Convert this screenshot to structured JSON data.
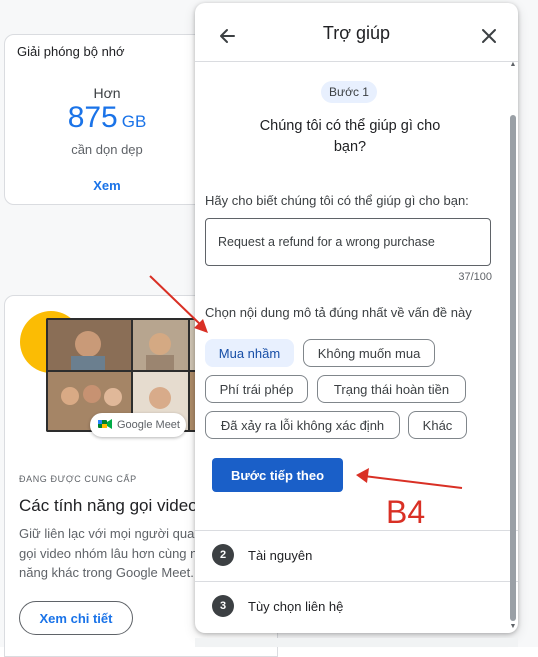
{
  "storage_card": {
    "title": "Giải phóng bộ nhớ",
    "prefix": "Hơn",
    "amount": "875",
    "unit": "GB",
    "subtitle": "cần dọn dẹp",
    "link": "Xem"
  },
  "meet_card": {
    "badge": "Google Meet",
    "label": "ĐANG ĐƯỢC CUNG CẤP",
    "title": "Các tính năng gọi video",
    "description": "Giữ liên lạc với mọi người qua gọi video nhóm lâu hơn cùng n năng khác trong Google Meet.",
    "button": "Xem chi tiết"
  },
  "help_panel": {
    "title": "Trợ giúp",
    "step_badge": "Bước 1",
    "question": "Chúng tôi có thể giúp gì cho bạn?",
    "field_label": "Hãy cho biết chúng tôi có thể giúp gì cho bạn:",
    "field_value": "Request a refund for a wrong purchase",
    "counter": "37/100",
    "choose_label": "Chọn nội dung mô tả đúng nhất về vấn đề này",
    "chips": [
      "Mua nhầm",
      "Không muốn mua",
      "Phí trái phép",
      "Trạng thái hoàn tiền",
      "Đã xảy ra lỗi không xác định",
      "Khác"
    ],
    "selected_chip": "Mua nhầm",
    "next_button": "Bước tiếp theo",
    "sections": [
      {
        "number": "2",
        "label": "Tài nguyên"
      },
      {
        "number": "3",
        "label": "Tùy chọn liên hệ"
      }
    ]
  },
  "annotation": {
    "label": "B4",
    "color": "#d93025"
  },
  "colors": {
    "accent": "#1a73e8",
    "primary_button": "#1a5fc8",
    "chip_selected": "#e8f0fe"
  }
}
